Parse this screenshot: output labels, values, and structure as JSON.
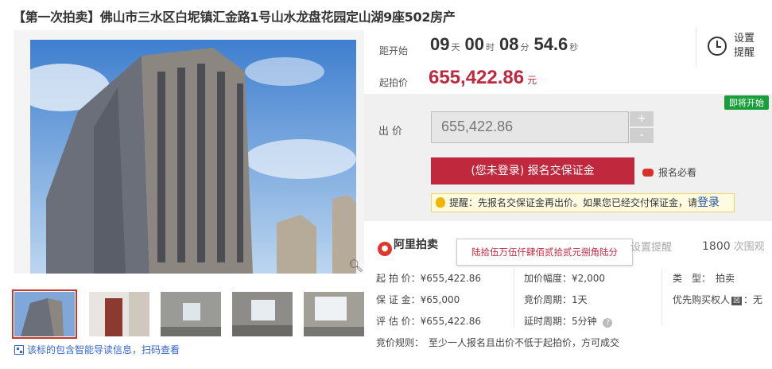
{
  "title": "【第一次拍卖】佛山市三水区白坭镇汇金路1号山水龙盘花园定山湖9座502房产",
  "countdown": {
    "label": "距开始",
    "days": "09",
    "days_unit": "天",
    "hours": "00",
    "hours_unit": "时",
    "minutes": "08",
    "minutes_unit": "分",
    "seconds": "54.6",
    "seconds_unit": "秒"
  },
  "setting": {
    "label": "设置提醒",
    "icon": "alarm-clock-icon"
  },
  "start_price": {
    "label": "起拍价",
    "amount": "655,422.86",
    "currency": "元"
  },
  "bid": {
    "badge": "即将开始",
    "label": "出价",
    "value": "655,422.86",
    "plus": "+",
    "minus": "-",
    "register_button": "(您未登录) 报名交保证金",
    "must_read": "报名必看",
    "tip_prefix": "提醒：",
    "tip_text": "先报名交保证金再出价。如果您已经交付保证金，请",
    "tip_login": "登录"
  },
  "platform": {
    "logo": "阿里拍卖"
  },
  "tooltip": "陆拾伍万伍仟肆佰贰拾贰元捌角陆分",
  "set_remind": "设置提醒",
  "views": {
    "count": "1800",
    "label": "次围观"
  },
  "details": {
    "start_price": "起 拍 价：¥655,422.86",
    "deposit": "保 证 金：¥65,000",
    "appraisal": "评 估 价：¥655,422.86",
    "increment": "加价幅度：¥2,000",
    "bid_cycle": "竞价周期：1天",
    "delay_cycle": "延时周期：5分钟",
    "type_label": "类　型：",
    "type_value": "拍卖",
    "priority_label": "优先购买权人",
    "priority_badge": "☒",
    "priority_value": "：无",
    "rule": "竞价规则：　至少一人报名且出价不低于起拍价，方可成交"
  },
  "qr_note": "该标的包含智能导读信息，扫码查看",
  "colors": {
    "accent": "#c0283e",
    "badge": "#1a9e3c",
    "link": "#3366cc"
  }
}
